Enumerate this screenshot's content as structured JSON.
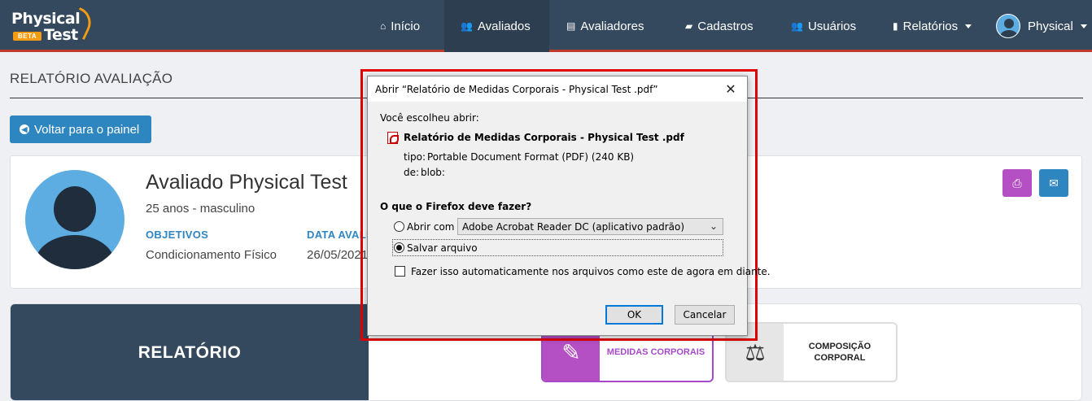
{
  "navbar": {
    "logo": {
      "line1": "Physical",
      "line2": "Test",
      "badge": "BETA"
    },
    "items": [
      {
        "label": "Início",
        "icon": "home-icon",
        "glyph": "⌂"
      },
      {
        "label": "Avaliados",
        "icon": "users-icon",
        "glyph": "👥"
      },
      {
        "label": "Avaliadores",
        "icon": "id-card-icon",
        "glyph": "▤"
      },
      {
        "label": "Cadastros",
        "icon": "book-icon",
        "glyph": "▰"
      },
      {
        "label": "Usuários",
        "icon": "users-icon",
        "glyph": "👥"
      },
      {
        "label": "Relatórios",
        "icon": "file-icon",
        "glyph": "▮"
      }
    ],
    "user": {
      "label": "Physical"
    }
  },
  "page": {
    "title": "RELATÓRIO AVALIAÇÃO",
    "back_button": "Voltar para o painel"
  },
  "profile": {
    "name": "Avaliado Physical Test",
    "info": "25 anos - masculino",
    "objetivos_label": "OBJETIVOS",
    "objetivos_value": "Condicionamento Físico",
    "data_label": "DATA AVALIAÇÃO",
    "data_value": "26/05/2021",
    "print_icon": "print-icon",
    "email_icon": "envelope-icon"
  },
  "report": {
    "heading": "RELATÓRIO",
    "tiles": [
      {
        "label": "MEDIDAS CORPORAIS",
        "color": "#a64ac9"
      },
      {
        "label": "COMPOSIÇÃO CORPORAL",
        "color": "#222222"
      }
    ]
  },
  "dialog": {
    "title": "Abrir “Relatório de Medidas Corporais - Physical Test .pdf”",
    "intro": "Você escolheu abrir:",
    "filename": "Relatório de Medidas Corporais - Physical Test .pdf",
    "type_label": "tipo:",
    "type_value": "Portable Document Format (PDF) (240 KB)",
    "from_label": "de:",
    "from_value": "blob:",
    "question": "O que o Firefox deve fazer?",
    "open_with_label": "Abrir com",
    "open_with_value": "Adobe Acrobat Reader DC (aplicativo padrão)",
    "save_label": "Salvar arquivo",
    "auto_label": "Fazer isso automaticamente nos arquivos como este de agora em diante.",
    "ok": "OK",
    "cancel": "Cancelar",
    "selected_option": "Salvar arquivo",
    "remember_checked": false
  },
  "colors": {
    "navbar": "#34495e",
    "accent": "#2e86c1",
    "highlight": "#e00000",
    "print_button": "#b54fc4",
    "email_button": "#2e86c1"
  }
}
